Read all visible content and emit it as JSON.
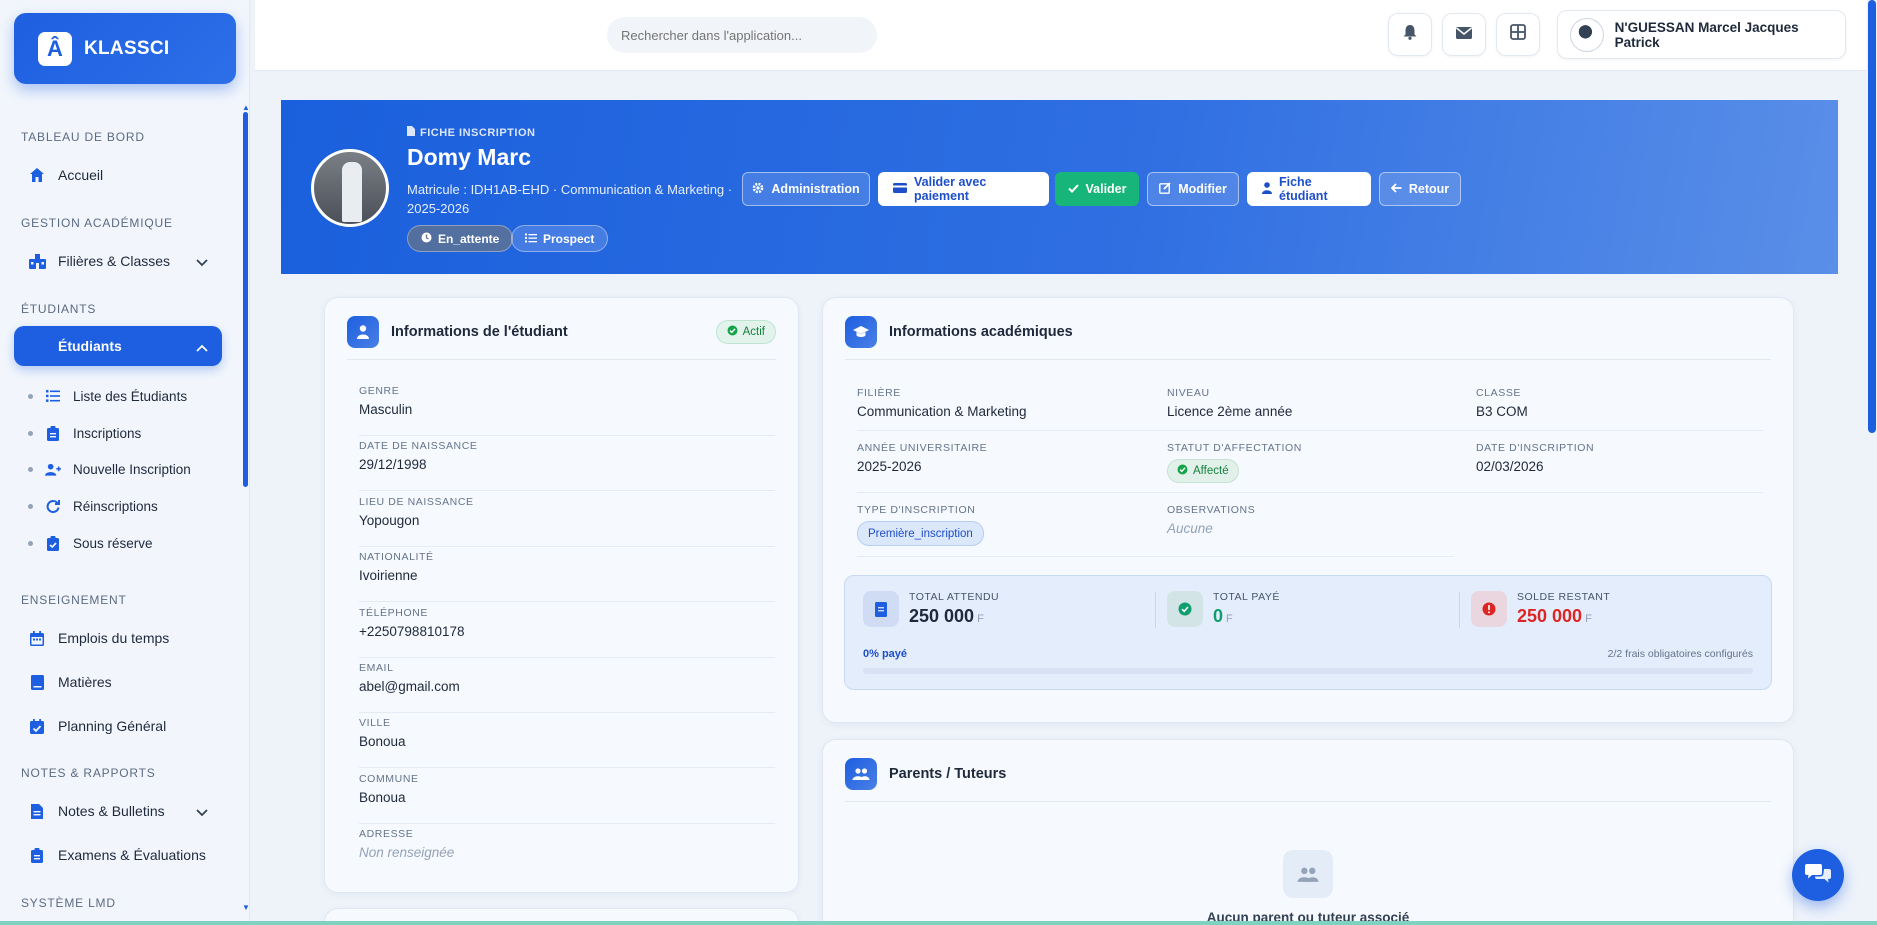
{
  "brand": {
    "name": "KLASSCI",
    "logo_letter": "Â"
  },
  "sidebar": {
    "sections": [
      {
        "title": "TABLEAU DE BORD"
      },
      {
        "title": "GESTION ACADÉMIQUE"
      },
      {
        "title": "ÉTUDIANTS"
      },
      {
        "title": "ENSEIGNEMENT"
      },
      {
        "title": "NOTES & RAPPORTS"
      },
      {
        "title": "SYSTÈME LMD"
      }
    ],
    "items": {
      "accueil": {
        "label": "Accueil",
        "icon": "home-icon"
      },
      "filieres": {
        "label": "Filières & Classes",
        "icon": "school-icon"
      },
      "etudiants": {
        "label": "Étudiants",
        "icon": "users-icon"
      },
      "emplois": {
        "label": "Emplois du temps",
        "icon": "calendar-icon"
      },
      "matieres": {
        "label": "Matières",
        "icon": "book-icon"
      },
      "planning": {
        "label": "Planning Général",
        "icon": "calendar-check-icon"
      },
      "notes": {
        "label": "Notes & Bulletins",
        "icon": "file-icon"
      },
      "examens": {
        "label": "Examens & Évaluations",
        "icon": "clipboard-icon"
      }
    },
    "subitems": [
      {
        "label": "Liste des Étudiants",
        "icon": "list-icon"
      },
      {
        "label": "Inscriptions",
        "icon": "clipboard-icon"
      },
      {
        "label": "Nouvelle Inscription",
        "icon": "user-plus-icon"
      },
      {
        "label": "Réinscriptions",
        "icon": "refresh-icon"
      },
      {
        "label": "Sous réserve",
        "icon": "clipboard-check-icon"
      }
    ]
  },
  "topbar": {
    "search_placeholder": "Rechercher dans l'application...",
    "user_name": "N'GUESSAN Marcel Jacques Patrick"
  },
  "hero": {
    "kicker": "FICHE INSCRIPTION",
    "name": "Domy Marc",
    "meta": "Matricule : IDH1AB-EHD · Communication & Marketing · 2025-2026",
    "badge_status": "En_attente",
    "badge_type": "Prospect",
    "buttons": {
      "administration": "Administration",
      "valider_paiement": "Valider avec paiement",
      "valider": "Valider",
      "modifier": "Modifier",
      "fiche": "Fiche étudiant",
      "retour": "Retour"
    }
  },
  "student_card": {
    "title": "Informations de l'étudiant",
    "status": "Actif",
    "fields": [
      {
        "label": "GENRE",
        "value": "Masculin"
      },
      {
        "label": "DATE DE NAISSANCE",
        "value": "29/12/1998"
      },
      {
        "label": "LIEU DE NAISSANCE",
        "value": "Yopougon"
      },
      {
        "label": "NATIONALITÉ",
        "value": "Ivoirienne"
      },
      {
        "label": "TÉLÉPHONE",
        "value": "+2250798810178"
      },
      {
        "label": "EMAIL",
        "value": "abel@gmail.com"
      },
      {
        "label": "VILLE",
        "value": "Bonoua"
      },
      {
        "label": "COMMUNE",
        "value": "Bonoua"
      },
      {
        "label": "ADRESSE",
        "value": "Non renseignée"
      }
    ]
  },
  "academic_card": {
    "title": "Informations académiques",
    "filiere": {
      "label": "FILIÈRE",
      "value": "Communication & Marketing"
    },
    "niveau": {
      "label": "NIVEAU",
      "value": "Licence 2ème année"
    },
    "classe": {
      "label": "CLASSE",
      "value": "B3 COM"
    },
    "annee": {
      "label": "ANNÉE UNIVERSITAIRE",
      "value": "2025-2026"
    },
    "statut": {
      "label": "STATUT D'AFFECTATION",
      "value": "Affecté"
    },
    "date": {
      "label": "DATE D'INSCRIPTION",
      "value": "02/03/2026"
    },
    "type": {
      "label": "TYPE D'INSCRIPTION",
      "value": "Première_inscription"
    },
    "observations": {
      "label": "OBSERVATIONS",
      "value": "Aucune"
    }
  },
  "finance": {
    "total_attendu": {
      "label": "TOTAL ATTENDU",
      "value": "250 000",
      "unit": "F"
    },
    "total_paye": {
      "label": "TOTAL PAYÉ",
      "value": "0",
      "unit": "F"
    },
    "solde": {
      "label": "SOLDE RESTANT",
      "value": "250 000",
      "unit": "F"
    },
    "percent_label": "0% payé",
    "percent_paid": 0,
    "note": "2/2 frais obligatoires configurés"
  },
  "parents_card": {
    "title": "Parents / Tuteurs",
    "empty_text": "Aucun parent ou tuteur associé"
  },
  "colors": {
    "primary": "#1d5fe0",
    "success": "#17b57a",
    "danger": "#dc2626"
  }
}
